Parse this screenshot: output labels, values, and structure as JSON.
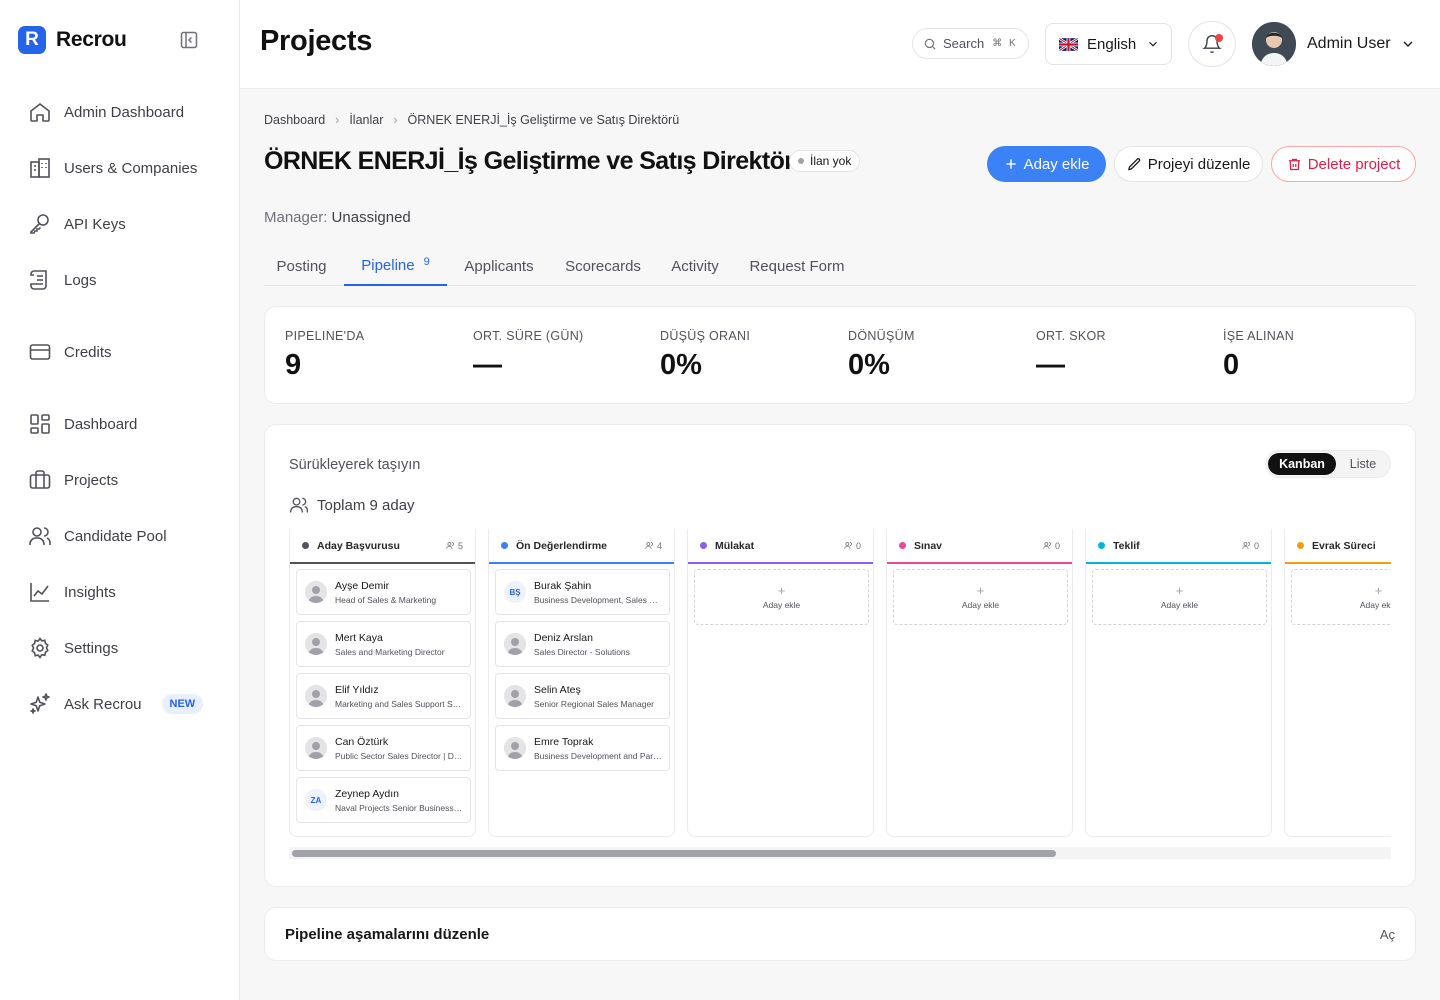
{
  "app": {
    "name": "Recrou",
    "logo_letter": "R"
  },
  "sidebar": {
    "items": [
      {
        "label": "Admin Dashboard",
        "icon": "home-icon"
      },
      {
        "label": "Users & Companies",
        "icon": "building-icon"
      },
      {
        "label": "API Keys",
        "icon": "key-icon"
      },
      {
        "label": "Logs",
        "icon": "scroll-icon"
      },
      {
        "label": "Credits",
        "icon": "credit-card-icon"
      },
      {
        "label": "Dashboard",
        "icon": "layout-dashboard-icon"
      },
      {
        "label": "Projects",
        "icon": "briefcase-icon"
      },
      {
        "label": "Candidate Pool",
        "icon": "users-icon"
      },
      {
        "label": "Insights",
        "icon": "chart-line-icon"
      },
      {
        "label": "Settings",
        "icon": "gear-icon"
      },
      {
        "label": "Ask Recrou",
        "icon": "sparkles-icon",
        "badge": "NEW"
      }
    ]
  },
  "header": {
    "title": "Projects",
    "search": {
      "placeholder": "Search",
      "shortcut": "⌘ K"
    },
    "language": "English",
    "user": {
      "name": "Admin User"
    }
  },
  "breadcrumb": [
    "Dashboard",
    "İlanlar",
    "ÖRNEK ENERJİ_İş Geliştirme ve Satış Direktörü"
  ],
  "project": {
    "title": "ÖRNEK ENERJİ_İş Geliştirme ve Satış Direktörü",
    "status": "İlan yok",
    "manager_key": "Manager:",
    "manager_value": "Unassigned"
  },
  "actions": {
    "add_candidate": "Aday ekle",
    "edit_project": "Projeyi düzenle",
    "delete_project": "Delete project"
  },
  "tabs": [
    {
      "label": "Posting"
    },
    {
      "label": "Pipeline",
      "count": "9",
      "active": true
    },
    {
      "label": "Applicants"
    },
    {
      "label": "Scorecards"
    },
    {
      "label": "Activity"
    },
    {
      "label": "Request Form"
    }
  ],
  "stats": [
    {
      "label": "PIPELINE'DA",
      "value": "9"
    },
    {
      "label": "ORT. SÜRE (GÜN)",
      "value": "—"
    },
    {
      "label": "DÜŞÜŞ ORANI",
      "value": "0%"
    },
    {
      "label": "DÖNÜŞÜM",
      "value": "0%"
    },
    {
      "label": "ORT. SKOR",
      "value": "—"
    },
    {
      "label": "İŞE ALINAN",
      "value": "0"
    }
  ],
  "board": {
    "hint": "Sürükleyerek taşıyın",
    "view_kanban": "Kanban",
    "view_list": "Liste",
    "total": "Toplam 9 aday",
    "add_label": "Aday ekle",
    "add_plus": "+",
    "columns": [
      {
        "name": "Aday Başvurusu",
        "count": "5",
        "color": "#52525b",
        "cards": [
          {
            "name": "Ayşe Demir",
            "role": "Head of Sales & Marketing"
          },
          {
            "name": "Mert Kaya",
            "role": "Sales and Marketing Director"
          },
          {
            "name": "Elif Yıldız",
            "role": "Marketing and Sales Support Specialist"
          },
          {
            "name": "Can Öztürk",
            "role": "Public Sector Sales Director | Defense"
          },
          {
            "name": "Zeynep Aydın",
            "role": "Naval Projects Senior Business Developer",
            "initials": "ZA"
          }
        ]
      },
      {
        "name": "Ön Değerlendirme",
        "count": "4",
        "color": "#3b82f6",
        "cards": [
          {
            "name": "Burak Şahin",
            "role": "Business Development, Sales Manager",
            "initials": "BŞ"
          },
          {
            "name": "Deniz Arslan",
            "role": "Sales Director - Solutions"
          },
          {
            "name": "Selin Ateş",
            "role": "Senior Regional Sales Manager"
          },
          {
            "name": "Emre Toprak",
            "role": "Business Development and Partnerships Lead"
          }
        ]
      },
      {
        "name": "Mülakat",
        "count": "0",
        "color": "#8b5cf6",
        "cards": []
      },
      {
        "name": "Sınav",
        "count": "0",
        "color": "#ec4899",
        "cards": []
      },
      {
        "name": "Teklif",
        "count": "0",
        "color": "#06b6d4",
        "cards": []
      },
      {
        "name": "Evrak Süreci",
        "count": "",
        "color": "#f59e0b",
        "cards": []
      }
    ]
  },
  "accordion": {
    "title": "Pipeline aşamalarını düzenle",
    "open_label": "Aç"
  }
}
